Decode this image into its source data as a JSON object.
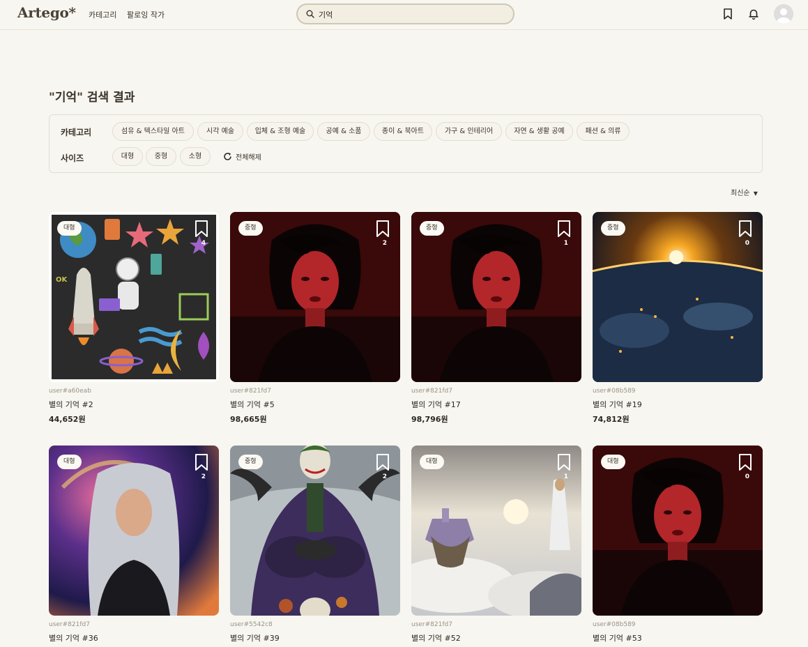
{
  "header": {
    "logo": "Artego*",
    "nav": [
      "카테고리",
      "팔로잉 작가"
    ],
    "search_value": "기억",
    "icons": [
      "bookmark-icon",
      "bell-icon",
      "avatar"
    ]
  },
  "page_title": "\"기억\" 검색 결과",
  "filters": {
    "category_label": "카테고리",
    "categories": [
      "섬유 & 텍스타일 아트",
      "시각 예술",
      "입체 & 조형 예술",
      "공예 & 소품",
      "종이 & 북아트",
      "가구 & 인테리어",
      "자연 & 생활 공예",
      "패션 & 의류"
    ],
    "size_label": "사이즈",
    "sizes": [
      "대형",
      "중형",
      "소형"
    ],
    "reset_label": "전체해제"
  },
  "sort_label": "최신순",
  "cards": [
    {
      "size": "대형",
      "count": "4",
      "user": "user#a60eab",
      "title": "별의 기억 #2",
      "price": "44,652원",
      "art": "space-doodle"
    },
    {
      "size": "중형",
      "count": "2",
      "user": "user#821fd7",
      "title": "별의 기억 #5",
      "price": "98,665원",
      "art": "red-woman"
    },
    {
      "size": "중형",
      "count": "1",
      "user": "user#821fd7",
      "title": "별의 기억 #17",
      "price": "98,796원",
      "art": "red-woman"
    },
    {
      "size": "중형",
      "count": "0",
      "user": "user#08b589",
      "title": "별의 기억 #19",
      "price": "74,812원",
      "art": "earth-sunrise"
    },
    {
      "size": "대형",
      "count": "2",
      "user": "user#821fd7",
      "title": "별의 기억 #36",
      "price": "",
      "art": "cosmic-woman"
    },
    {
      "size": "중형",
      "count": "2",
      "user": "user#5542c8",
      "title": "별의 기억 #39",
      "price": "",
      "art": "joker"
    },
    {
      "size": "대형",
      "count": "1",
      "user": "user#821fd7",
      "title": "별의 기억 #52",
      "price": "",
      "art": "floating-castle"
    },
    {
      "size": "대형",
      "count": "0",
      "user": "user#08b589",
      "title": "별의 기억 #53",
      "price": "",
      "art": "red-woman"
    }
  ]
}
